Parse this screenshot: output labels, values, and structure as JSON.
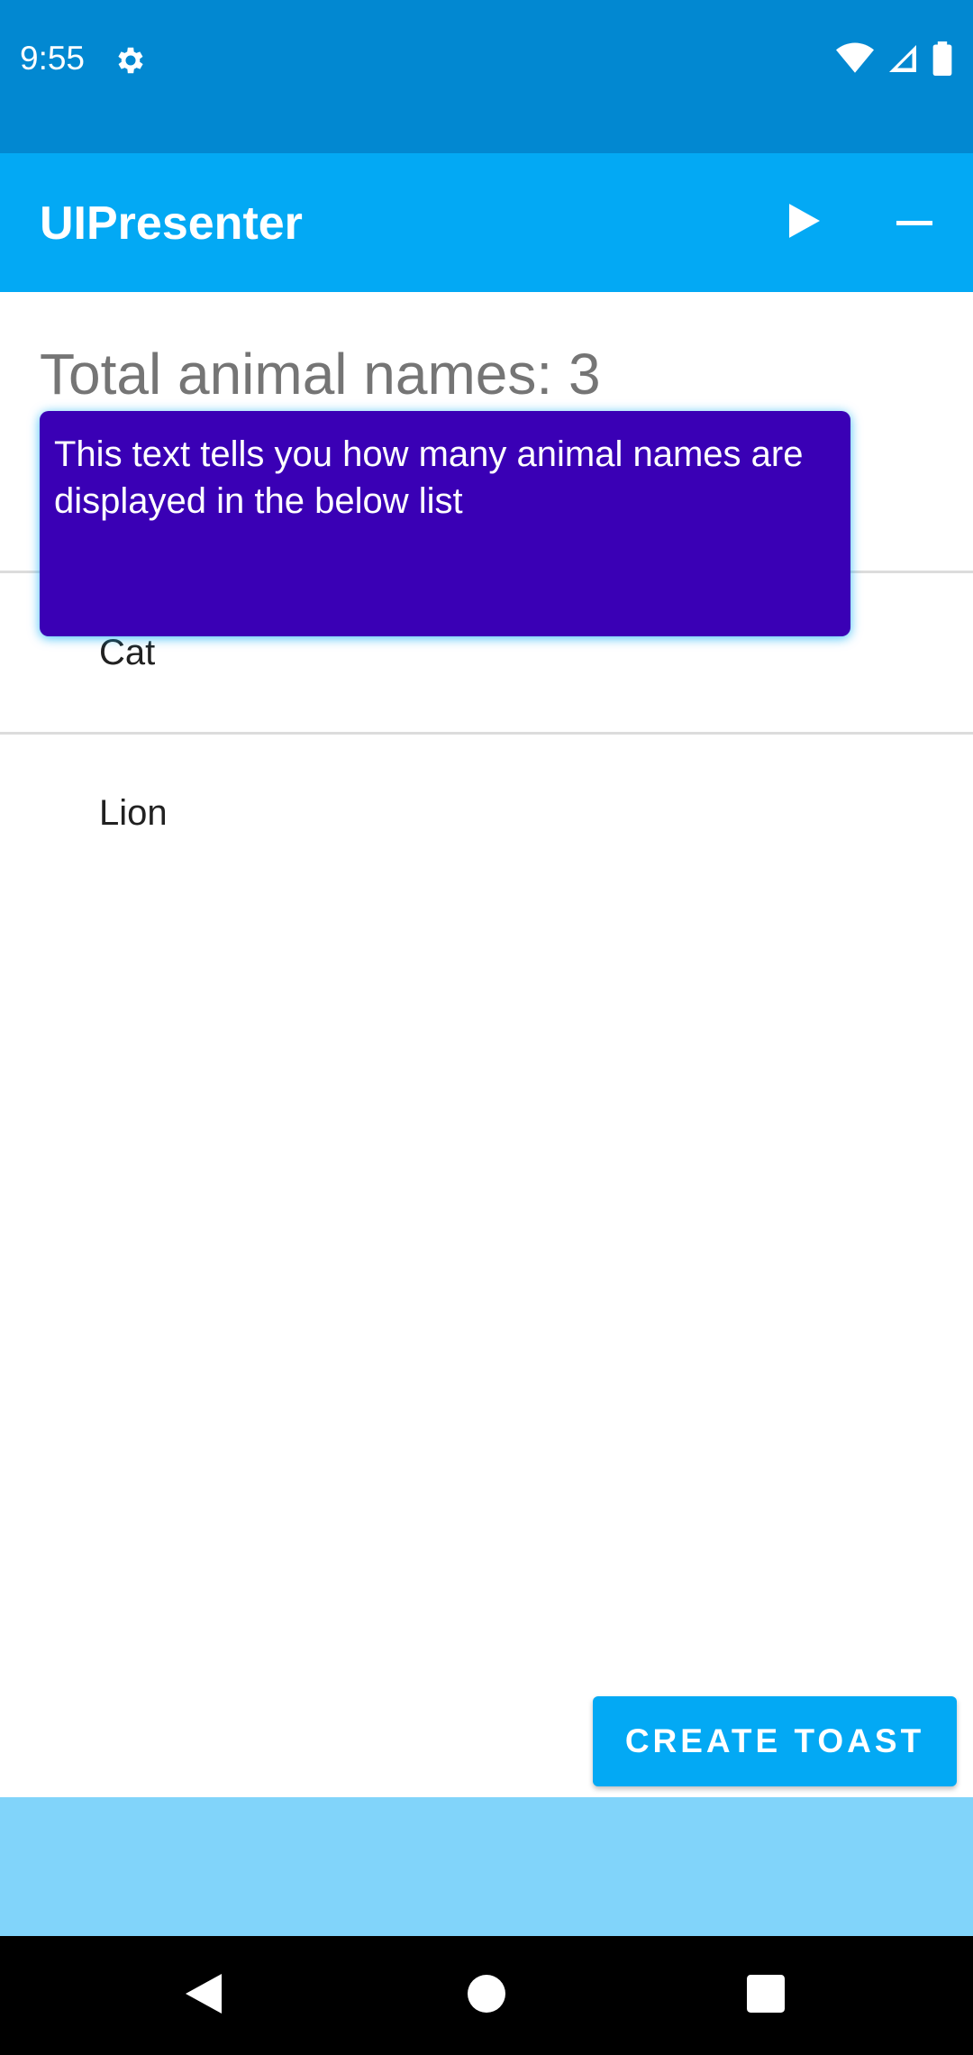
{
  "status_bar": {
    "time": "9:55",
    "icons": [
      "gear-icon",
      "wifi-icon",
      "signal-icon",
      "battery-icon"
    ]
  },
  "app_bar": {
    "title": "UIPresenter",
    "actions": [
      "play-icon",
      "minus-icon"
    ]
  },
  "main": {
    "total_label": "Total animal names: 3",
    "tooltip": "This text tells you how many animal names are displayed in the below list",
    "list_items": [
      "Cat",
      "Lion"
    ]
  },
  "toast_button": {
    "label": "CREATE TOAST"
  },
  "nav": {
    "icons": [
      "back-icon",
      "home-icon",
      "recents-icon"
    ]
  },
  "colors": {
    "status_bar": "#0288d1",
    "app_bar": "#03a9f4",
    "tooltip_bg": "#3a00b5",
    "bottom_panel": "#81d4fa",
    "nav_bar": "#000000"
  }
}
